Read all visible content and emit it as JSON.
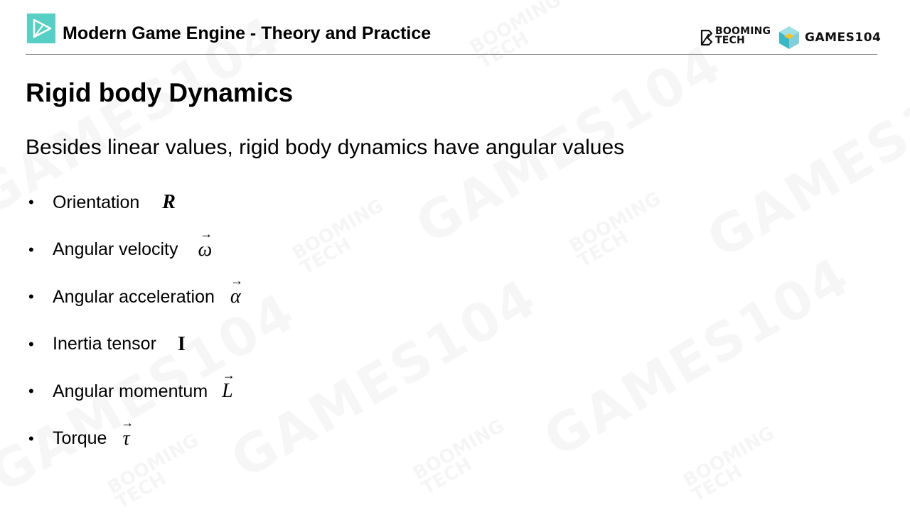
{
  "header": {
    "title": "Modern Game Engine - Theory and Practice",
    "booming_tech_line1": "BOOMING",
    "booming_tech_line2": "TECH",
    "games104_text": "GAMES104"
  },
  "watermark": {
    "big": "GAMES104",
    "small_line1": "BOOMING",
    "small_line2": "TECH"
  },
  "slide": {
    "title": "Rigid body Dynamics",
    "intro": "Besides linear values, rigid body dynamics have angular values",
    "bullets": [
      {
        "label": "Orientation",
        "symbol": "R",
        "vector": false,
        "style": "bold-italic"
      },
      {
        "label": "Angular velocity",
        "symbol": "ω",
        "vector": true,
        "style": "italic"
      },
      {
        "label": "Angular acceleration",
        "symbol": "α",
        "vector": true,
        "style": "italic"
      },
      {
        "label": "Inertia tensor",
        "symbol": "I",
        "vector": false,
        "style": "bold"
      },
      {
        "label": "Angular momentum",
        "symbol": "L",
        "vector": true,
        "style": "italic"
      },
      {
        "label": "Torque",
        "symbol": "τ",
        "vector": true,
        "style": "italic"
      }
    ],
    "bullet_glyph": "•",
    "arrow_glyph": "⃗"
  },
  "colors": {
    "accent_teal": "#57cfc4",
    "rule": "#7a7a7a"
  }
}
